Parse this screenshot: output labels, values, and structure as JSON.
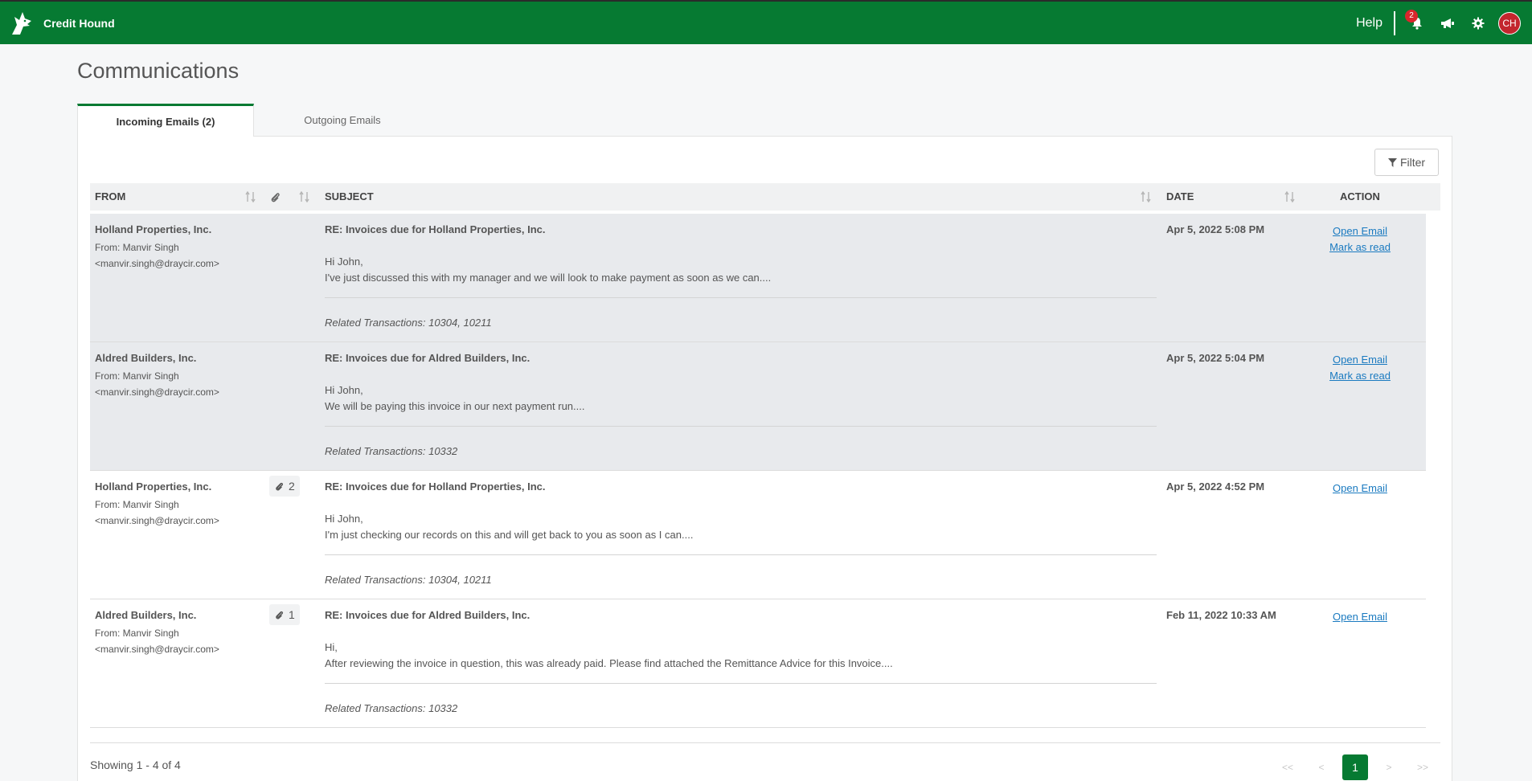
{
  "app": {
    "name": "Credit Hound",
    "help": "Help",
    "notifications_count": "2",
    "avatar_initials": "CH"
  },
  "page": {
    "title": "Communications"
  },
  "tabs": [
    {
      "label": "Incoming Emails (2)"
    },
    {
      "label": "Outgoing Emails"
    }
  ],
  "filter_label": "Filter",
  "table": {
    "headers": {
      "from": "FROM",
      "subject": "SUBJECT",
      "date": "DATE",
      "action": "ACTION"
    },
    "rows": [
      {
        "from": "Holland Properties, Inc.",
        "sender_line1": "From: Manvir Singh",
        "sender_line2": "<manvir.singh@draycir.com>",
        "attachments": "",
        "subject": "RE: Invoices due for Holland Properties, Inc.",
        "greeting": "Hi John,",
        "preview": "I've just discussed this with my manager and we will look to make payment as soon as we can....",
        "related": "Related Transactions: 10304, 10211",
        "date": "Apr 5, 2022 5:08 PM",
        "open": "Open Email",
        "mark": "Mark as read"
      },
      {
        "from": "Aldred Builders, Inc.",
        "sender_line1": "From: Manvir Singh",
        "sender_line2": "<manvir.singh@draycir.com>",
        "attachments": "",
        "subject": "RE: Invoices due for Aldred Builders, Inc.",
        "greeting": "Hi John,",
        "preview": "We will be paying this invoice in our next payment run....",
        "related": "Related Transactions: 10332",
        "date": "Apr 5, 2022 5:04 PM",
        "open": "Open Email",
        "mark": "Mark as read"
      },
      {
        "from": "Holland Properties, Inc.",
        "sender_line1": "From: Manvir Singh",
        "sender_line2": "<manvir.singh@draycir.com>",
        "attachments": "2",
        "subject": "RE: Invoices due for Holland Properties, Inc.",
        "greeting": "Hi John,",
        "preview": "I'm just checking our records on this and will get back to you as soon as I can....",
        "related": "Related Transactions: 10304, 10211",
        "date": "Apr 5, 2022 4:52 PM",
        "open": "Open Email",
        "mark": ""
      },
      {
        "from": "Aldred Builders, Inc.",
        "sender_line1": "From: Manvir Singh",
        "sender_line2": "<manvir.singh@draycir.com>",
        "attachments": "1",
        "subject": "RE: Invoices due for Aldred Builders, Inc.",
        "greeting": "Hi,",
        "preview": "After reviewing the invoice in question, this was already paid. Please find attached the Remittance Advice for this Invoice....",
        "related": "Related Transactions: 10332",
        "date": "Feb 11, 2022 10:33 AM",
        "open": "Open Email",
        "mark": ""
      }
    ]
  },
  "pagination": {
    "showing": "Showing  1 - 4  of  4",
    "first": "<<",
    "prev": "<",
    "current": "1",
    "next": ">",
    "last": ">>"
  },
  "colors": {
    "brand": "#067a32",
    "link": "#1a7ac0",
    "unread_bg": "#e8eaed",
    "badge": "#d9262c"
  }
}
